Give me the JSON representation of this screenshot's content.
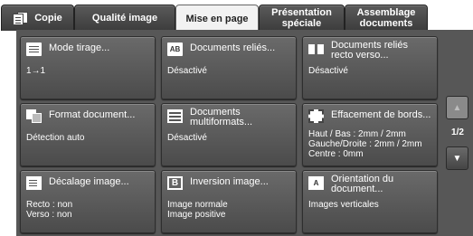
{
  "tabs": [
    {
      "label": "Copie",
      "icon": "copy-icon"
    },
    {
      "label": "Qualité image"
    },
    {
      "label": "Mise en page",
      "active": true
    },
    {
      "label": "Présentation\nspéciale"
    },
    {
      "label": "Assemblage\ndocuments"
    }
  ],
  "features": [
    {
      "title": "Mode tirage...",
      "value": "1→1",
      "icon": "document-icon"
    },
    {
      "title": "Documents reliés...",
      "value": "Désactivé",
      "icon": "bound-documents-icon"
    },
    {
      "title": "Documents reliés\nrecto verso...",
      "value": "Désactivé",
      "icon": "open-book-icon"
    },
    {
      "title": "Format document...",
      "value": "Détection auto",
      "icon": "document-size-icon"
    },
    {
      "title": "Documents\nmultiformats...",
      "value": "Désactivé",
      "icon": "mixed-size-icon"
    },
    {
      "title": "Effacement de bords...",
      "value": "Haut / Bas : 2mm / 2mm\nGauche/Droite : 2mm / 2mm\nCentre : 0mm",
      "icon": "edge-erase-icon"
    },
    {
      "title": "Décalage image...",
      "value": "Recto : non\nVerso : non",
      "icon": "image-shift-icon"
    },
    {
      "title": "Inversion image...",
      "value": "Image normale\nImage positive",
      "icon": "invert-image-icon"
    },
    {
      "title": "Orientation du\ndocument...",
      "value": "Images verticales",
      "icon": "orientation-icon"
    }
  ],
  "pager": {
    "indicator": "1/2",
    "up_icon": "arrow-up-icon",
    "down_icon": "arrow-down-icon"
  }
}
